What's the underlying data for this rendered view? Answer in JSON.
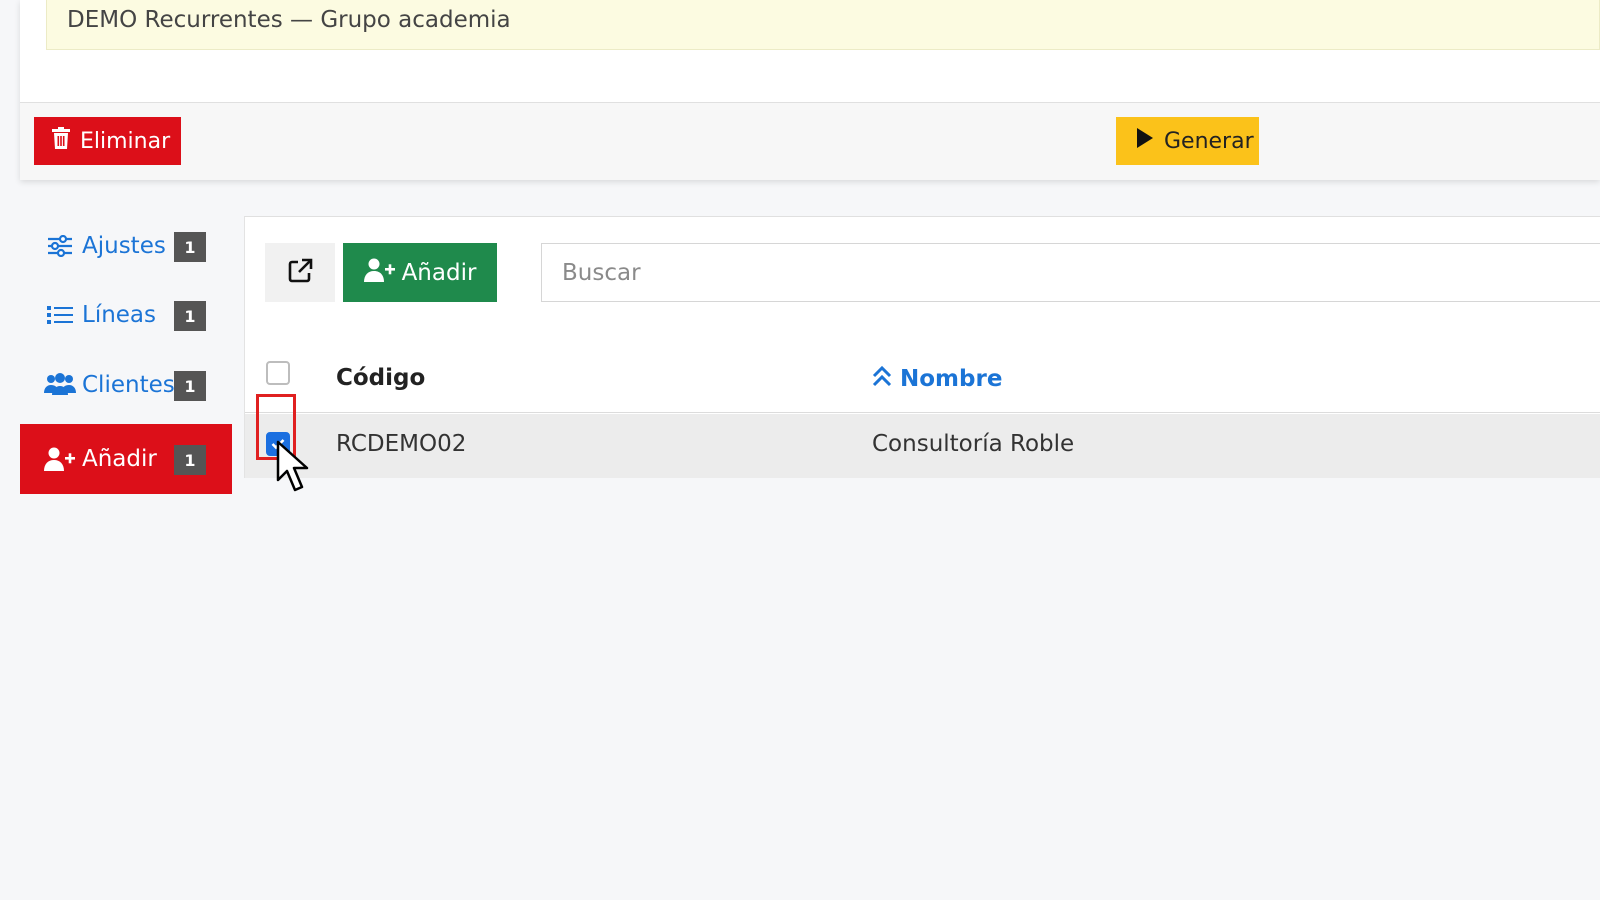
{
  "header": {
    "notice_text": "DEMO Recurrentes — Grupo academia"
  },
  "actions": {
    "delete_label": "Eliminar",
    "generate_label": "Generar"
  },
  "sidebar": {
    "items": [
      {
        "label": "Ajustes",
        "badge": "1",
        "icon": "sliders-icon"
      },
      {
        "label": "Líneas",
        "badge": "1",
        "icon": "list-icon"
      },
      {
        "label": "Clientes",
        "badge": "1",
        "icon": "users-icon"
      },
      {
        "label": "Añadir",
        "badge": "1",
        "icon": "user-plus-icon",
        "active": true
      }
    ]
  },
  "toolbar": {
    "add_label": "Añadir",
    "search_placeholder": "Buscar"
  },
  "table": {
    "columns": [
      "Código",
      "Nombre"
    ],
    "sorted_column": "Nombre",
    "rows": [
      {
        "code": "RCDEMO02",
        "name": "Consultoría Roble",
        "checked": true
      }
    ]
  },
  "colors": {
    "danger": "#dc0f19",
    "warning": "#fbc21a",
    "success": "#1f8a4c",
    "link": "#1b74d6"
  }
}
